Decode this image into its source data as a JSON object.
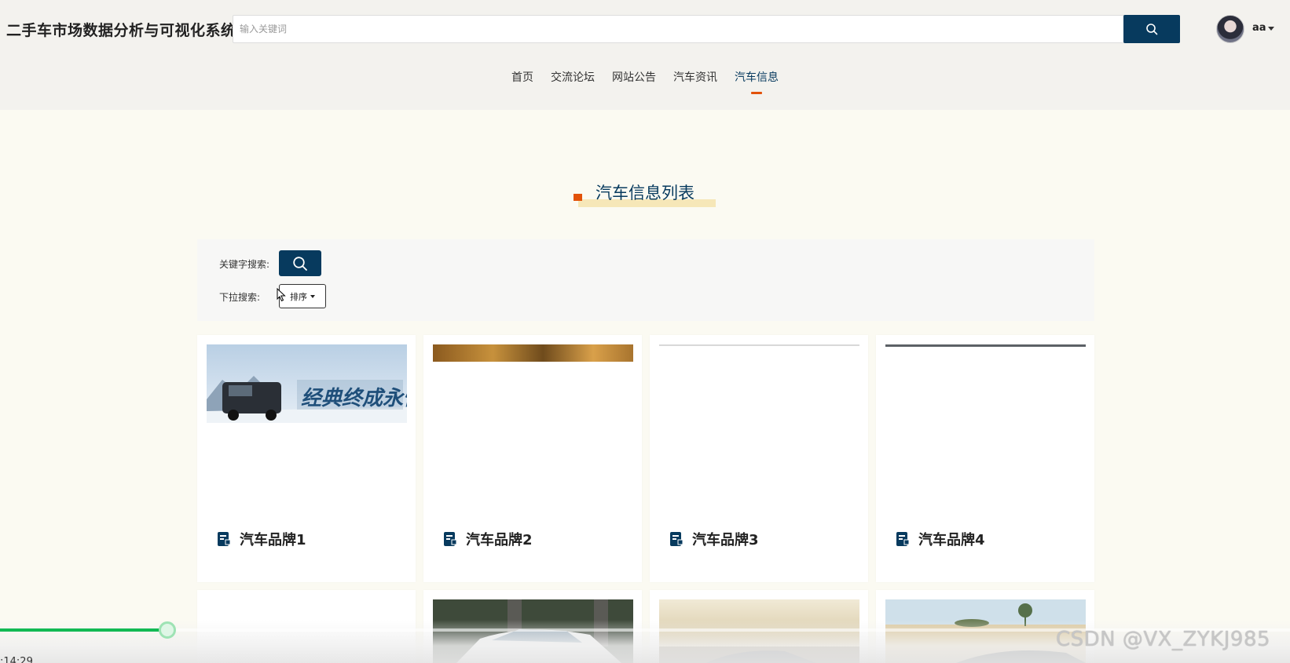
{
  "header": {
    "brand": "二手车市场数据分析与可视化系统",
    "search_placeholder": "输入关键词",
    "user_name": "aa"
  },
  "nav": {
    "items": [
      {
        "label": "首页",
        "active": false
      },
      {
        "label": "交流论坛",
        "active": false
      },
      {
        "label": "网站公告",
        "active": false
      },
      {
        "label": "汽车资讯",
        "active": false
      },
      {
        "label": "汽车信息",
        "active": true
      }
    ]
  },
  "section": {
    "title": "汽车信息列表"
  },
  "filters": {
    "keyword_label": "关键字搜索:",
    "dropdown_label": "下拉搜索:",
    "sort_label": "排序"
  },
  "cards": [
    {
      "title": "汽车品牌1",
      "image_text": "经典终成永恒"
    },
    {
      "title": "汽车品牌2"
    },
    {
      "title": "汽车品牌3"
    },
    {
      "title": "汽车品牌4"
    }
  ],
  "video": {
    "time": ":14:29",
    "progress": 0.13,
    "watermark": "CSDN @VX_ZYKJ985"
  },
  "colors": {
    "primary": "#073a5e",
    "accent": "#e2520a",
    "progress": "#12b954",
    "background": "#fbfaf2"
  }
}
